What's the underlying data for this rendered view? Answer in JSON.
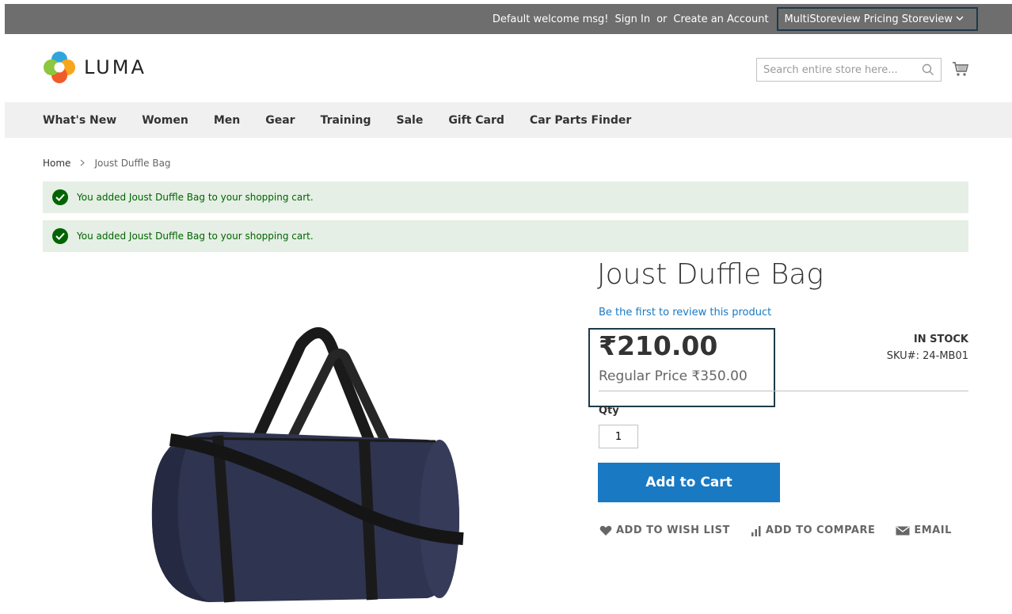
{
  "topbar": {
    "welcome": "Default welcome msg!",
    "sign_in": "Sign In",
    "or": "or",
    "create_account": "Create an Account",
    "storeview": "MultiStoreview Pricing Storeview"
  },
  "header": {
    "logo_text": "LUMA",
    "search_placeholder": "Search entire store here...",
    "search_value": ""
  },
  "nav": {
    "items": [
      "What's New",
      "Women",
      "Men",
      "Gear",
      "Training",
      "Sale",
      "Gift Card",
      "Car Parts Finder"
    ]
  },
  "breadcrumb": {
    "home": "Home",
    "current": "Joust Duffle Bag"
  },
  "messages": [
    "You added Joust Duffle Bag to your shopping cart.",
    "You added Joust Duffle Bag to your shopping cart."
  ],
  "product": {
    "title": "Joust Duffle Bag",
    "review_link": "Be the first to review this product",
    "price": "₹210.00",
    "regular_price": "Regular Price ₹350.00",
    "stock": "IN STOCK",
    "sku": "SKU#:  24-MB01",
    "qty_label": "Qty",
    "qty_value": "1",
    "add_to_cart": "Add to Cart",
    "actions": {
      "wishlist": "ADD TO WISH LIST",
      "compare": "ADD TO COMPARE",
      "email": "EMAIL"
    }
  },
  "colors": {
    "topbar": "#6e6e6e",
    "accent": "#1979c3",
    "success_bg": "#e5efe5",
    "success_text": "#006400",
    "highlight_border": "#1d3a4a"
  }
}
